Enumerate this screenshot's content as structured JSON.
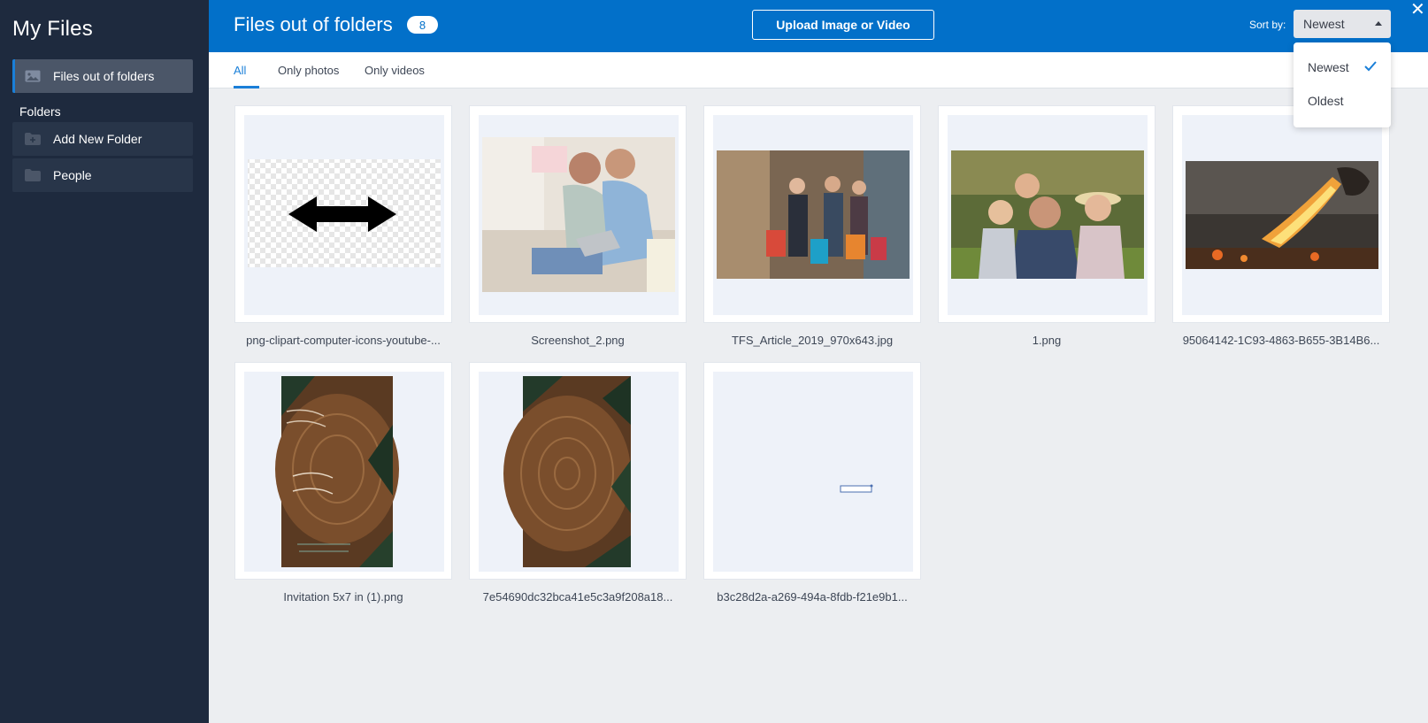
{
  "sidebar": {
    "title": "My Files",
    "active_item": "Files out of folders",
    "section_label": "Folders",
    "items": [
      {
        "label": "Add New Folder",
        "icon": "folder-plus-icon"
      },
      {
        "label": "People",
        "icon": "folder-icon"
      }
    ]
  },
  "header": {
    "title": "Files out of folders",
    "count": "8",
    "upload_label": "Upload Image or Video",
    "sort_label": "Sort by:",
    "sort_value": "Newest",
    "close_glyph": "✕"
  },
  "tabs": [
    {
      "label": "All",
      "active": true
    },
    {
      "label": "Only photos"
    },
    {
      "label": "Only videos"
    }
  ],
  "sort_options": [
    {
      "label": "Newest",
      "selected": true
    },
    {
      "label": "Oldest"
    }
  ],
  "files": [
    {
      "name": "png-clipart-computer-icons-youtube-..."
    },
    {
      "name": "Screenshot_2.png"
    },
    {
      "name": "TFS_Article_2019_970x643.jpg"
    },
    {
      "name": "1.png"
    },
    {
      "name": "95064142-1C93-4863-B655-3B14B6..."
    },
    {
      "name": "Invitation 5x7 in (1).png"
    },
    {
      "name": "7e54690dc32bca41e5c3a9f208a18..."
    },
    {
      "name": "b3c28d2a-a269-494a-8fdb-f21e9b1..."
    }
  ],
  "colors": {
    "sidebar_bg": "#1e2a3e",
    "header_bg": "#0270c9",
    "accent": "#1a7fd8"
  }
}
